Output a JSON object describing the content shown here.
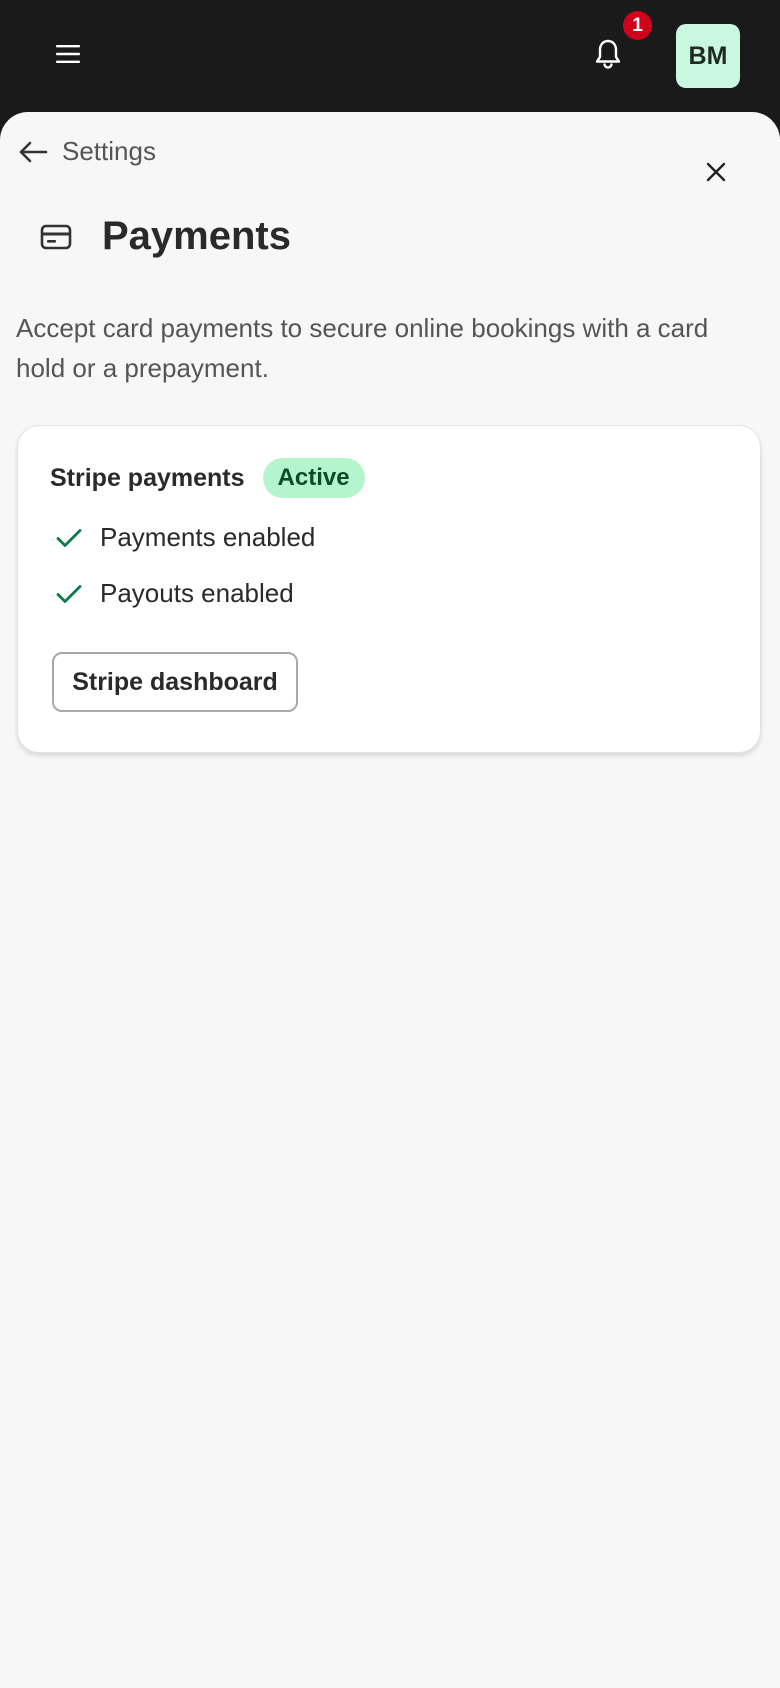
{
  "app_bar": {
    "menu_icon": "hamburger-menu-icon",
    "bell_icon": "bell-icon",
    "notification_count": "1",
    "avatar_initials": "BM"
  },
  "header": {
    "back_label": "Settings",
    "back_icon": "arrow-left-icon",
    "close_icon": "close-icon",
    "page_icon": "credit-card-icon",
    "title": "Payments"
  },
  "description": "Accept card payments to secure online bookings with a card hold or a prepayment.",
  "stripe_card": {
    "title": "Stripe payments",
    "status": "Active",
    "checks": [
      {
        "label": "Payments enabled",
        "icon": "check-icon"
      },
      {
        "label": "Payouts enabled",
        "icon": "check-icon"
      }
    ],
    "dashboard_button": "Stripe dashboard"
  },
  "colors": {
    "app_bar_bg": "#1a1a1a",
    "sheet_bg": "#f7f7f7",
    "badge_red": "#d0021b",
    "avatar_bg": "#c9f7df",
    "status_green_bg": "#b4f5cd",
    "status_green_text": "#0b4d2a",
    "check_green": "#0a7a4a"
  }
}
